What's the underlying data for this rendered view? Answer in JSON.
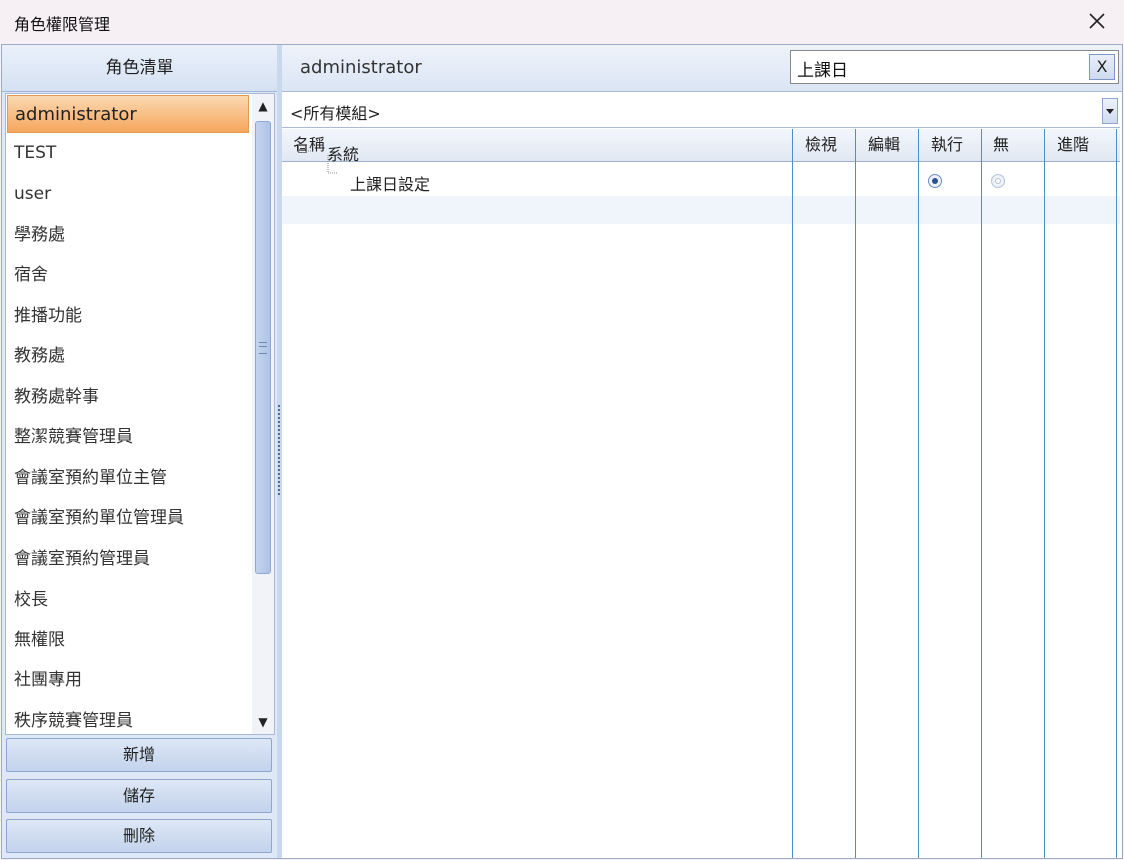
{
  "window": {
    "title": "角色權限管理",
    "close_icon": "close-icon"
  },
  "left_panel": {
    "header": "角色清單",
    "roles": [
      "administrator",
      "TEST",
      "user",
      "學務處",
      "宿舍",
      "推播功能",
      "教務處",
      "教務處幹事",
      "整潔競賽管理員",
      "會議室預約單位主管",
      "會議室預約單位管理員",
      "會議室預約管理員",
      "校長",
      "無權限",
      "社團專用",
      "秩序競賽管理員"
    ],
    "selected_role": "administrator",
    "buttons": {
      "add": "新增",
      "save": "儲存",
      "delete": "刪除"
    }
  },
  "right_panel": {
    "role_name": "administrator",
    "search": {
      "value": "上課日",
      "clear_label": "X"
    },
    "module_filter": {
      "selected": "<所有模組>"
    },
    "grid": {
      "columns": {
        "name": "名稱",
        "view": "檢視",
        "edit": "編輯",
        "execute": "執行",
        "none": "無",
        "advanced": "進階"
      },
      "tree": {
        "group": "系統",
        "child": "上課日設定",
        "child_permission": "執行"
      }
    }
  },
  "colors": {
    "selection": "#f5a65c",
    "grid_line": "#4a90cf",
    "panel_bg": "#dfe8f6"
  }
}
